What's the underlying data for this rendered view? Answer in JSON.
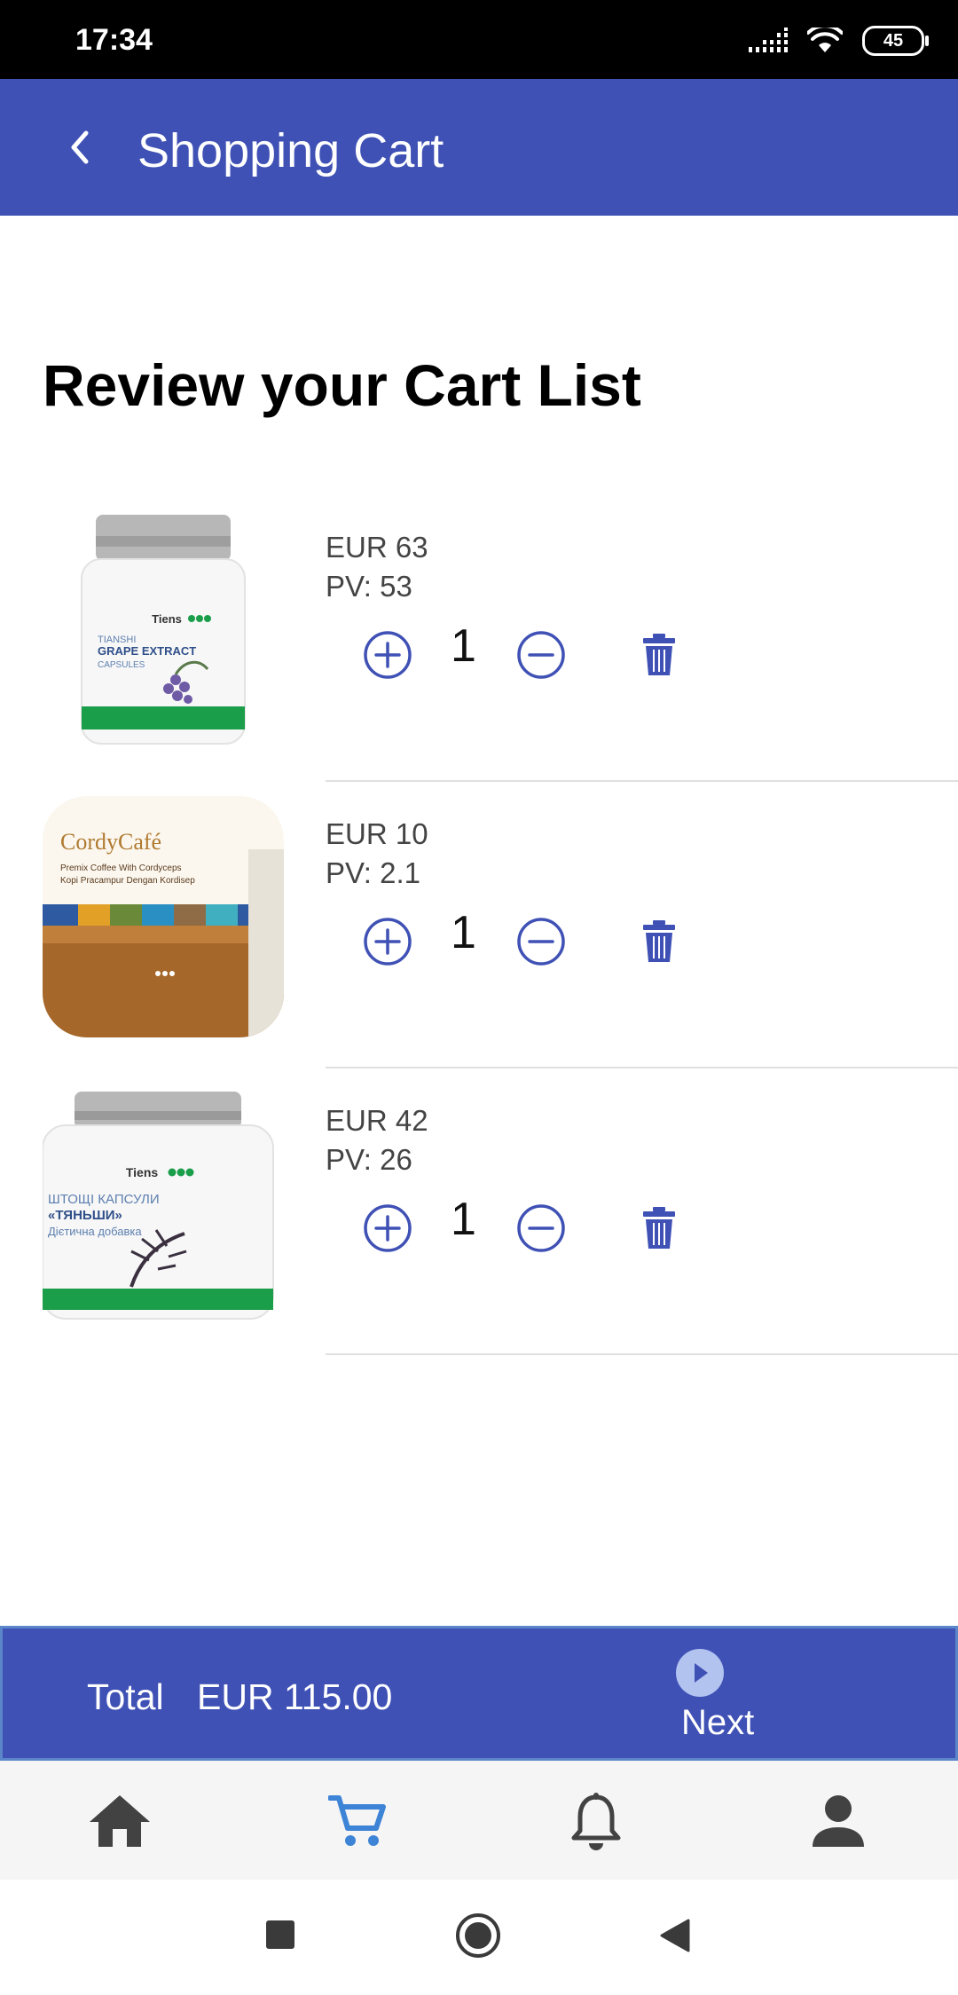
{
  "status_bar": {
    "time": "17:34",
    "battery": "45"
  },
  "app_bar": {
    "title": "Shopping Cart"
  },
  "heading": "Review your Cart List",
  "items": [
    {
      "name": "Tiens Tianshi Grape Extract Capsules",
      "price": "EUR 63",
      "pv": "PV: 53",
      "quantity": "1",
      "image": "grape-extract-bottle"
    },
    {
      "name": "CordyCafé",
      "price": "EUR 10",
      "pv": "PV: 2.1",
      "quantity": "1",
      "image": "cordycafe-box"
    },
    {
      "name": "Tiens Tianshi capsules",
      "price": "EUR 42",
      "pv": "PV: 26",
      "quantity": "1",
      "image": "tianshi-bottle"
    }
  ],
  "product_image_text": {
    "brand": "Tiens",
    "grape_extract": [
      "TIANSHI",
      "GRAPE EXTRACT",
      "CAPSULES"
    ],
    "cordycafe": [
      "CordyCafé",
      "Premix Coffee With Cordyceps",
      "Kopi Pracampur Dengan Kordisep"
    ],
    "tianshi": [
      "ШТОЩІ КАПСУЛИ",
      "«ТЯНЬШИ»",
      "Дієтична добавка"
    ]
  },
  "total_bar": {
    "label": "Total",
    "value": "EUR 115.00",
    "next_label": "Next"
  },
  "bottom_nav": [
    "home-icon",
    "cart-icon",
    "bell-icon",
    "person-icon"
  ],
  "colors": {
    "primary": "#3f51b5",
    "active_tab": "#3d83d6",
    "icon_gray": "#424242"
  }
}
